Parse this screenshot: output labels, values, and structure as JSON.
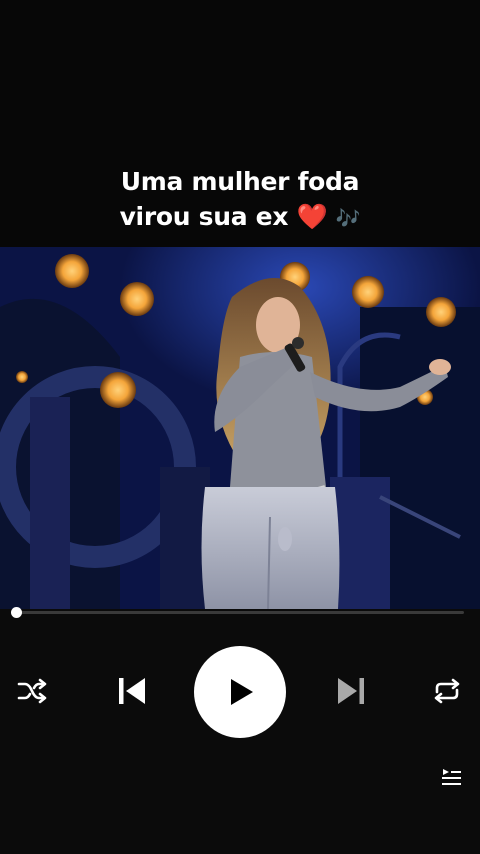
{
  "caption": {
    "line1": "Uma mulher foda",
    "line2_text": "virou sua ex",
    "line2_emoji_heart": "❤️",
    "line2_emoji_notes": "🎶"
  },
  "video": {
    "description_icon": "concert-performer-image"
  },
  "player": {
    "progress": 0.0,
    "controls": [
      "shuffle-icon",
      "previous-icon",
      "play-icon",
      "next-icon",
      "repeat-icon",
      "queue-icon"
    ]
  },
  "colors": {
    "background": "#000000",
    "text": "#ffffff",
    "heart": "#e0182d",
    "progress_track": "#3a3a3a",
    "stage_blue": "#1a2f8a",
    "stage_light": "#f4a53a"
  }
}
